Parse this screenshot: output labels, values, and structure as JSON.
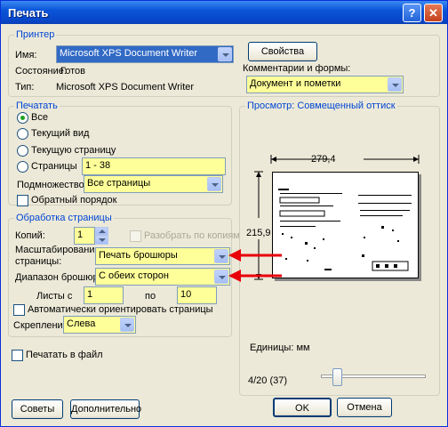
{
  "window": {
    "title": "Печать",
    "help_label": "?",
    "close_label": "✕"
  },
  "printer": {
    "group_label": "Принтер",
    "name_label": "Имя:",
    "name_value": "Microsoft XPS Document Writer",
    "status_label": "Состояние:",
    "status_value": "Готов",
    "type_label": "Тип:",
    "type_value": "Microsoft XPS Document Writer",
    "properties_button": "Свойства",
    "comments_label": "Комментарии и формы:",
    "comments_value": "Документ и пометки"
  },
  "print_range": {
    "group_label": "Печатать",
    "options": [
      "Все",
      "Текущий вид",
      "Текущую страницу",
      "Страницы"
    ],
    "selected": "Все",
    "pages_value": "1 - 38",
    "subset_label": "Подмножество:",
    "subset_value": "Все страницы",
    "reverse_label": "Обратный порядок"
  },
  "handling": {
    "group_label": "Обработка страницы",
    "copies_label": "Копий:",
    "copies_value": "1",
    "collate_label": "Разобрать по копиям",
    "scaling_label_1": "Масштабирование",
    "scaling_label_2": "страницы:",
    "scaling_value": "Печать брошюры",
    "booklet_label": "Диапазон брошюры:",
    "booklet_value": "С обеих сторон",
    "sheets_from_label": "Листы с",
    "sheets_from_value": "1",
    "sheets_to_label": "по",
    "sheets_to_value": "10",
    "auto_rotate_label": "Автоматически ориентировать страницы",
    "binding_label": "Скрепление:",
    "binding_value": "Слева"
  },
  "print_to_file_label": "Печатать в файл",
  "preview": {
    "group_label": "Просмотр: Совмещенный оттиск",
    "width_value": "279,4",
    "height_value": "215,9",
    "units_label": "Единицы: мм",
    "page_indicator": "4/20 (37)",
    "slider_position": 0.12
  },
  "buttons": {
    "tips": "Советы",
    "advanced": "Дополнительно",
    "ok": "OK",
    "cancel": "Отмена"
  },
  "colors": {
    "field_highlight": "#ffff99",
    "accent_red": "#e8000b",
    "group_label": "#0046d5"
  }
}
